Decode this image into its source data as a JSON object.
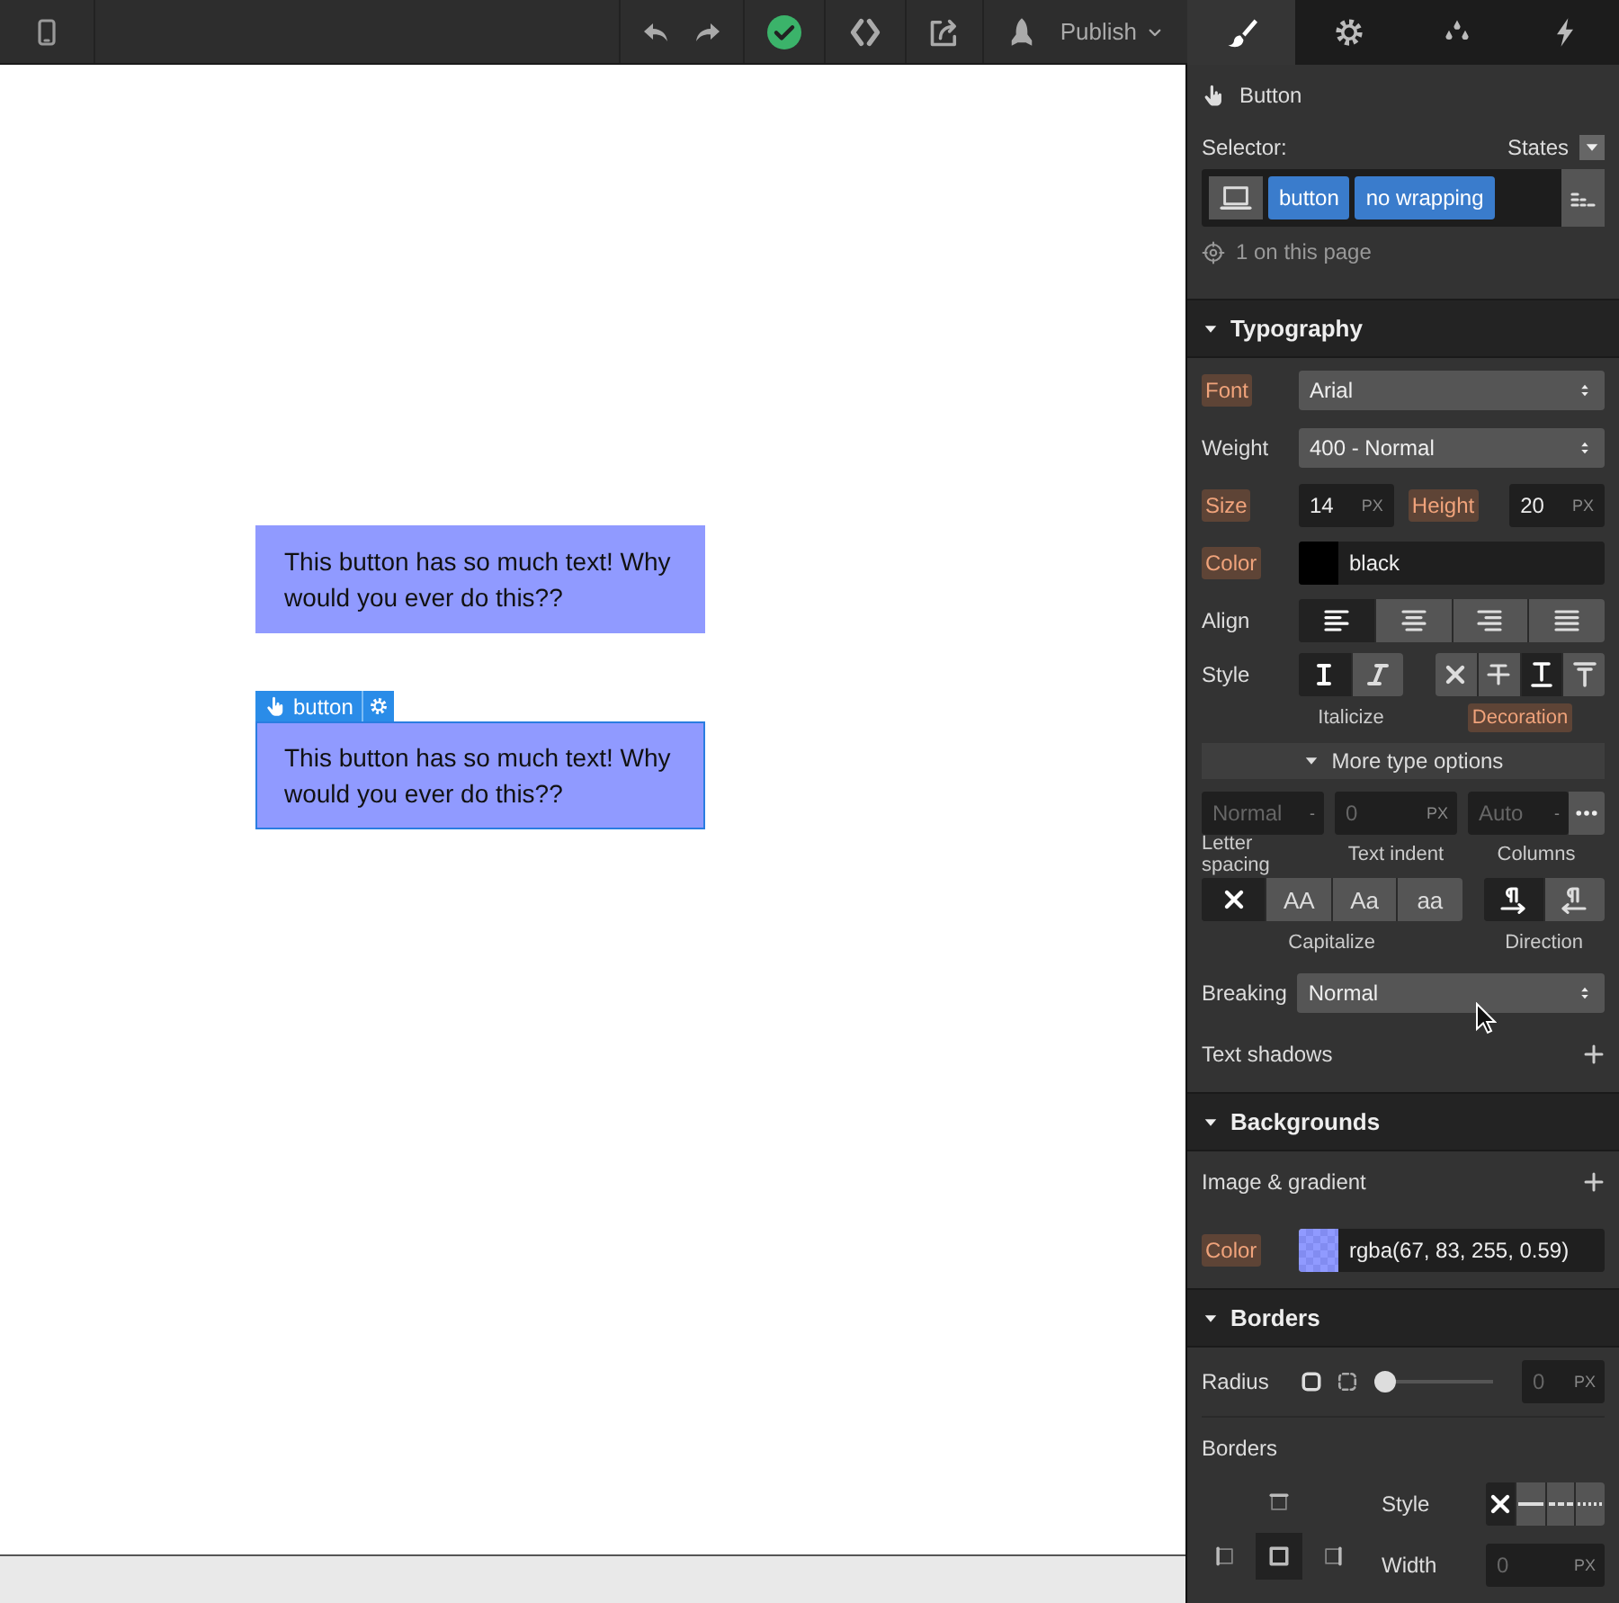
{
  "toolbar": {
    "publish": "Publish"
  },
  "panel_tabs": [
    {
      "selected": true
    },
    {
      "selected": false
    },
    {
      "selected": false
    },
    {
      "selected": false
    }
  ],
  "canvas": {
    "elements": [
      {
        "text": "This button has so much text! Why would you ever do this??",
        "selected": false
      },
      {
        "text": "This button has so much text! Why would you ever do this??",
        "selected": true,
        "tag": "button"
      }
    ]
  },
  "element": {
    "type": "Button"
  },
  "selector": {
    "label": "Selector:",
    "states": "States",
    "classes": [
      "button",
      "no wrapping"
    ],
    "count": "1 on this page"
  },
  "typography": {
    "title": "Typography",
    "font": {
      "label": "Font",
      "highlighted": true,
      "value": "Arial"
    },
    "weight": {
      "label": "Weight",
      "highlighted": false,
      "value": "400 - Normal"
    },
    "size": {
      "label": "Size",
      "highlighted": true,
      "value": "14",
      "unit": "PX"
    },
    "height": {
      "label": "Height",
      "highlighted": true,
      "value": "20",
      "unit": "PX"
    },
    "color": {
      "label": "Color",
      "highlighted": true,
      "value": "black"
    },
    "align": {
      "label": "Align",
      "options": [
        {
          "selected": true
        },
        {
          "selected": false
        },
        {
          "selected": false
        },
        {
          "selected": false
        }
      ]
    },
    "style": {
      "label": "Style",
      "italic": [
        {
          "selected": true
        },
        {
          "selected": false
        }
      ],
      "italic_label": "Italicize",
      "italic_highlighted": false,
      "decoration": [
        {
          "selected": false
        },
        {
          "selected": false
        },
        {
          "selected": true
        },
        {
          "selected": false
        }
      ],
      "decoration_label": "Decoration",
      "decoration_highlighted": true
    },
    "more_options": "More type options",
    "letter_spacing": {
      "placeholder": "Normal",
      "unit": "-",
      "label": "Letter spacing"
    },
    "text_indent": {
      "placeholder": "0",
      "unit": "PX",
      "label": "Text indent"
    },
    "columns": {
      "placeholder": "Auto",
      "unit": "-",
      "label": "Columns"
    },
    "capitalize": {
      "label": "Capitalize",
      "options": [
        {
          "selected": true
        },
        {
          "text": "AA",
          "selected": false
        },
        {
          "text": "Aa",
          "selected": false
        },
        {
          "text": "aa",
          "selected": false
        }
      ]
    },
    "direction": {
      "label": "Direction",
      "options": [
        {
          "selected": true
        },
        {
          "selected": false
        }
      ]
    },
    "breaking": {
      "label": "Breaking",
      "value": "Normal"
    },
    "text_shadows": "Text shadows"
  },
  "backgrounds": {
    "title": "Backgrounds",
    "image_gradient": "Image & gradient",
    "color": {
      "label": "Color",
      "highlighted": true,
      "value": "rgba(67, 83, 255, 0.59)"
    }
  },
  "borders": {
    "title": "Borders",
    "radius": {
      "label": "Radius",
      "level": 0,
      "placeholder": "0",
      "unit": "PX"
    },
    "label": "Borders",
    "sides": [
      {
        "selected": false
      },
      {
        "selected": false
      },
      {
        "selected": true
      },
      {
        "selected": false
      }
    ],
    "style": {
      "label": "Style",
      "options": [
        {
          "selected": true
        },
        {
          "selected": false
        },
        {
          "selected": false
        },
        {
          "selected": false
        }
      ]
    },
    "width": {
      "label": "Width",
      "placeholder": "0",
      "unit": "PX"
    }
  }
}
